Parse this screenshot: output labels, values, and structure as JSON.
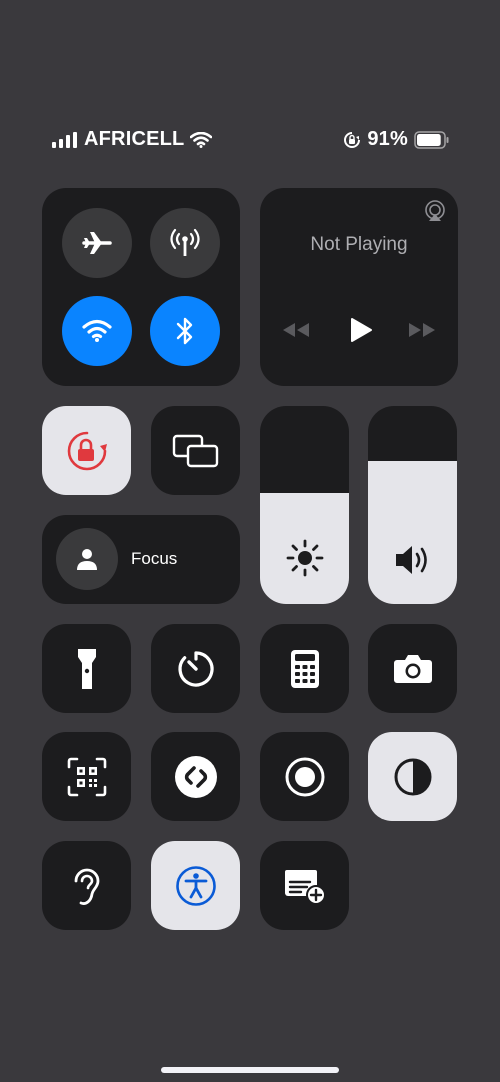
{
  "status_bar": {
    "carrier": "AFRICELL",
    "battery_percent": "91%",
    "signal_bars": 4,
    "battery_level": 0.91
  },
  "connectivity": {
    "airplane_mode": false,
    "cellular_data": false,
    "wifi": true,
    "bluetooth": true,
    "accent_color": "#0a84ff"
  },
  "now_playing": {
    "title": "Not Playing"
  },
  "focus": {
    "label": "Focus"
  },
  "brightness": {
    "level": 0.56
  },
  "volume": {
    "level": 0.72
  },
  "controls": {
    "orientation_lock": true,
    "dark_mode": true,
    "accessibility_shortcut": true,
    "lock_color": "#e0393e"
  },
  "icons": [
    "airplane-icon",
    "cellular-icon",
    "wifi-icon",
    "bluetooth-icon",
    "airplay-icon",
    "rewind-icon",
    "play-icon",
    "fast-forward-icon",
    "orientation-lock-icon",
    "screen-mirroring-icon",
    "person-icon",
    "sun-icon",
    "speaker-icon",
    "flashlight-icon",
    "timer-icon",
    "calculator-icon",
    "camera-icon",
    "qr-code-icon",
    "shazam-icon",
    "screen-record-icon",
    "dark-mode-icon",
    "ear-icon",
    "accessibility-icon",
    "quick-note-icon"
  ]
}
